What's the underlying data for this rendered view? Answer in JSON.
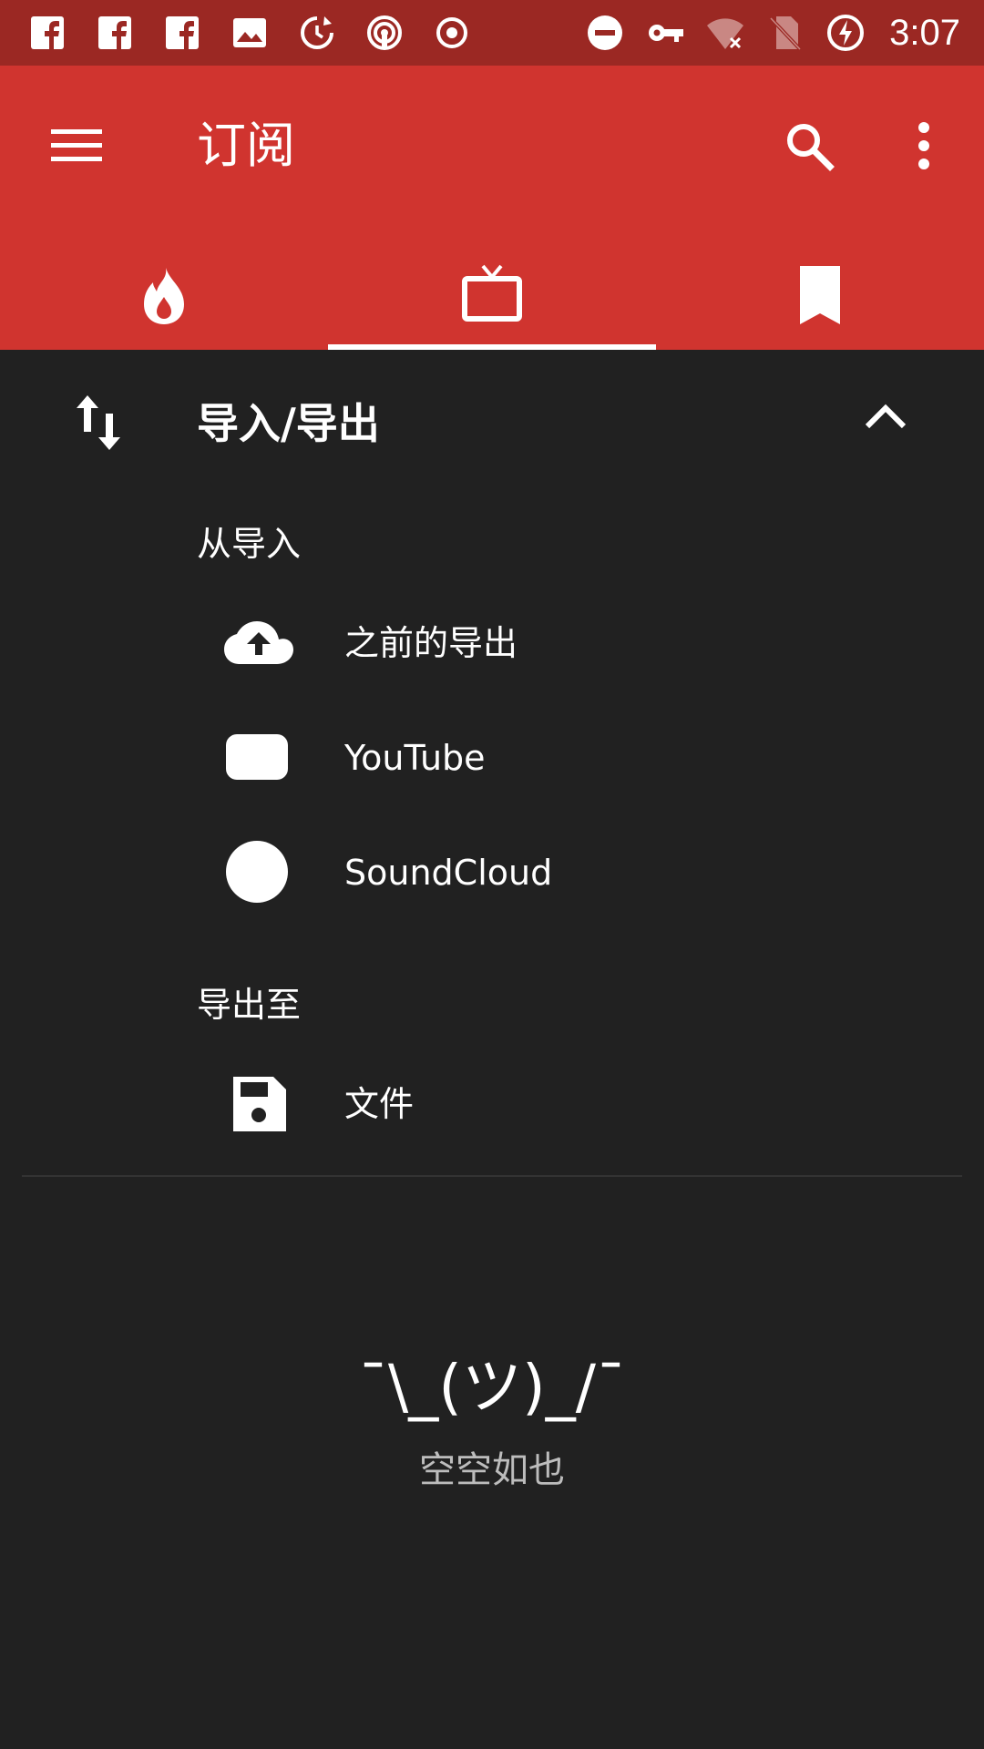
{
  "status_bar": {
    "time": "3:07",
    "left_icons": [
      "facebook-icon",
      "facebook-icon",
      "facebook-icon",
      "image-icon",
      "refresh-icon",
      "podcast-icon",
      "record-icon"
    ],
    "right_icons": [
      "do-not-disturb-icon",
      "vpn-key-icon",
      "wifi-off-icon",
      "no-sim-icon",
      "battery-charging-icon"
    ],
    "bg_color": "#9b2823"
  },
  "app_bar": {
    "title": "订阅",
    "bg_color": "#d0342f",
    "tabs": [
      {
        "icon": "fire-icon",
        "selected": false
      },
      {
        "icon": "tv-icon",
        "selected": true
      },
      {
        "icon": "bookmark-icon",
        "selected": false
      }
    ]
  },
  "import_export": {
    "title": "导入/导出",
    "import_heading": "从导入",
    "import_options": [
      {
        "label": "之前的导出",
        "icon": "cloud-upload-icon"
      },
      {
        "label": "YouTube",
        "icon": "youtube-icon"
      },
      {
        "label": "SoundCloud",
        "icon": "soundcloud-icon"
      }
    ],
    "export_heading": "导出至",
    "export_options": [
      {
        "label": "文件",
        "icon": "save-icon"
      }
    ]
  },
  "empty_state": {
    "emoticon": "¯\\_(ツ)_/¯",
    "message": "空空如也"
  }
}
